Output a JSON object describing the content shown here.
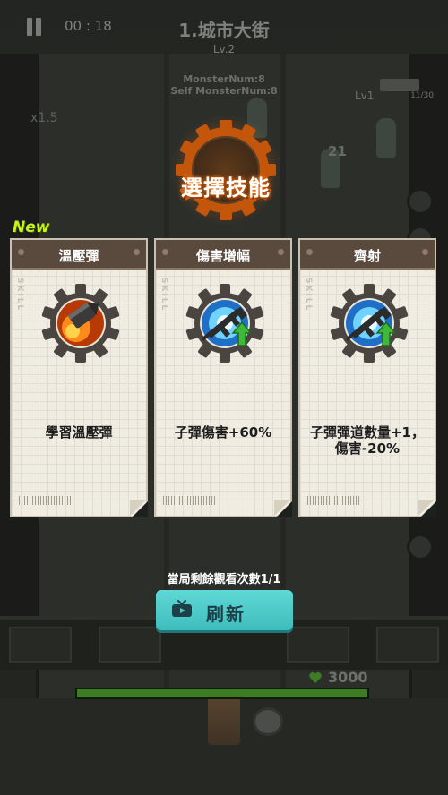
{
  "hud": {
    "timer": "00 : 18",
    "level_title": "1.城市大街",
    "level_sub": "Lv.2",
    "monster_num": "MonsterNum:8",
    "self_monster_num": "Self MonsterNum:8",
    "speed": "x1.5",
    "weapon_level": "Lv1",
    "ammo": "11/30",
    "damage_popup": "21"
  },
  "skill_panel": {
    "title": "選擇技能",
    "new_badge": "New",
    "side_label": "SKILL"
  },
  "cards": [
    {
      "title": "溫壓彈",
      "description": "學習溫壓彈",
      "icon": "thermobaric-bullet-icon"
    },
    {
      "title": "傷害增幅",
      "description": "子彈傷害+60%",
      "icon": "rifle-upgrade-icon"
    },
    {
      "title": "齊射",
      "description": "子彈彈道數量+1，傷害-20%",
      "icon": "rifle-upgrade-icon"
    }
  ],
  "footer": {
    "watch_remaining": "當局剩餘觀看次數1/1",
    "refresh_label": "刷新",
    "hp_value": "3000",
    "hp_fraction": 1.0
  },
  "colors": {
    "accent_orange": "#ff7a1a",
    "new_badge": "#c6f21d",
    "refresh_button": "#4fcaca",
    "card_header": "#5a4a3e",
    "hp_green": "#3d7c22"
  }
}
